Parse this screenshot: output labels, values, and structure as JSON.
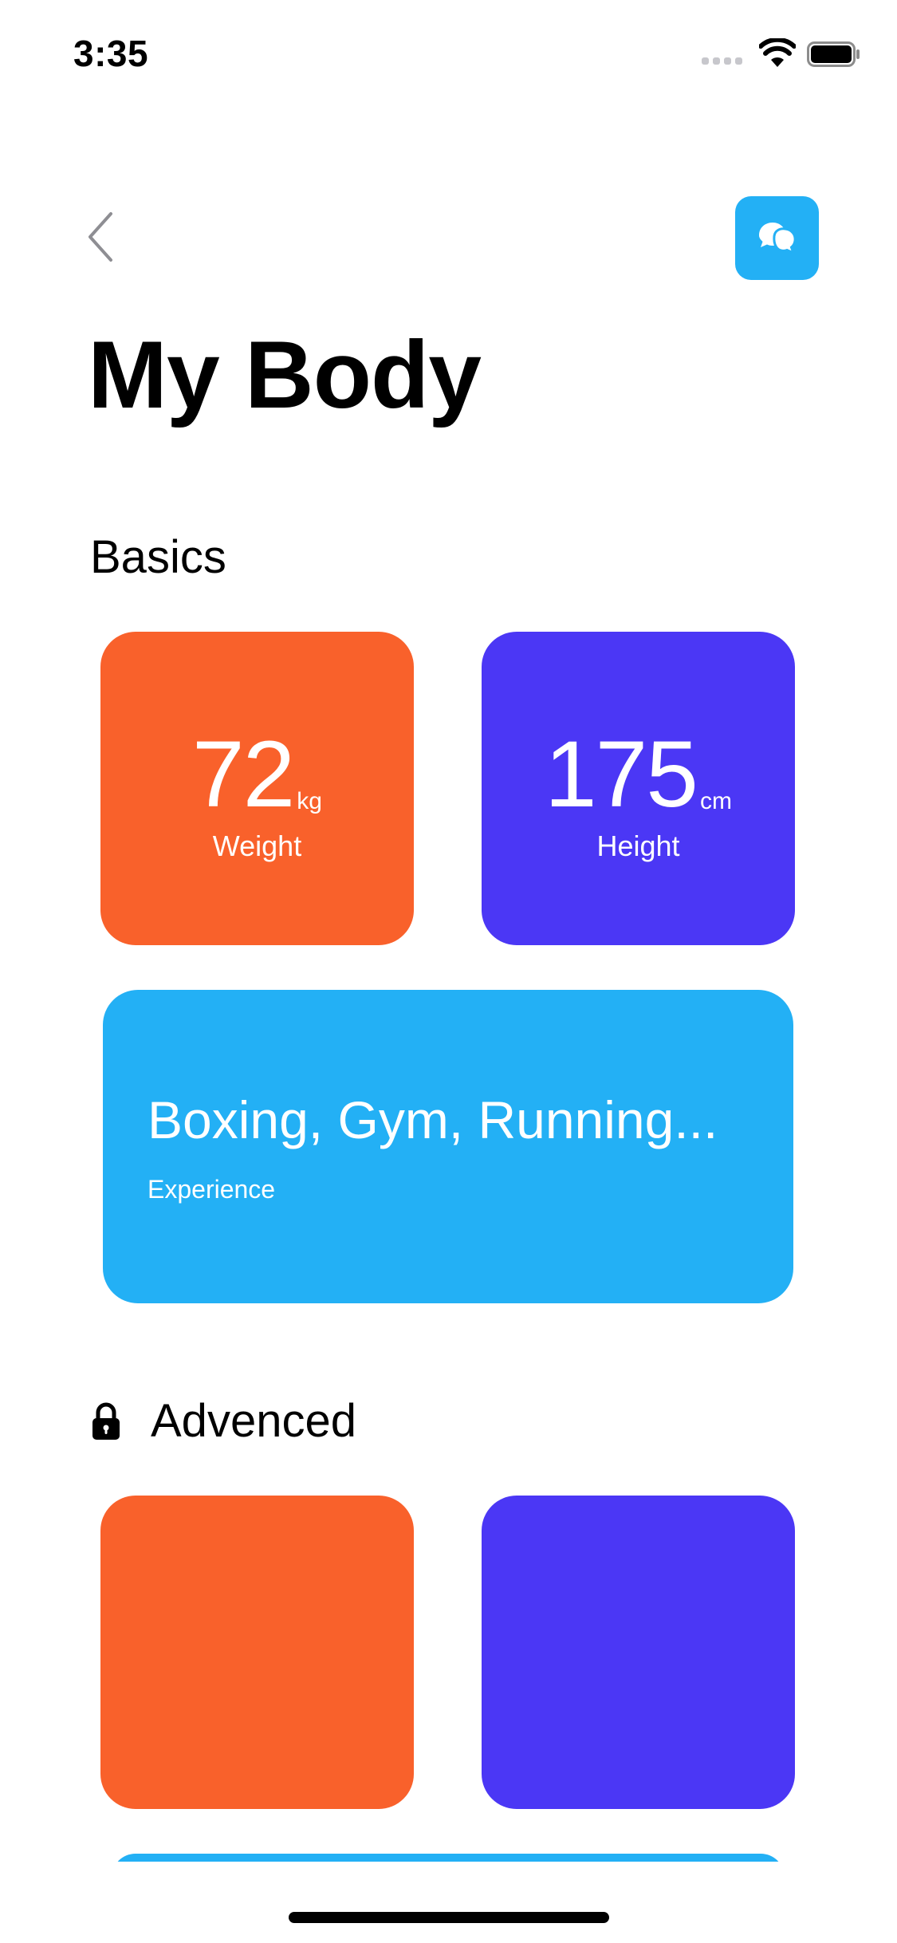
{
  "status_bar": {
    "time": "3:35"
  },
  "header": {
    "title": "My Body",
    "back_icon": "chevron-left-icon",
    "chat_icon": "chat-bubbles-icon"
  },
  "sections": {
    "basics": {
      "title": "Basics",
      "weight": {
        "value": "72",
        "unit": "kg",
        "label": "Weight"
      },
      "height": {
        "value": "175",
        "unit": "cm",
        "label": "Height"
      },
      "experience": {
        "value": "Boxing, Gym, Running...",
        "label": "Experience"
      }
    },
    "advanced": {
      "title": "Advenced",
      "icon": "lock-icon"
    }
  },
  "colors": {
    "orange": "#f9612b",
    "purple": "#4b37f5",
    "blue": "#23b0f5"
  }
}
